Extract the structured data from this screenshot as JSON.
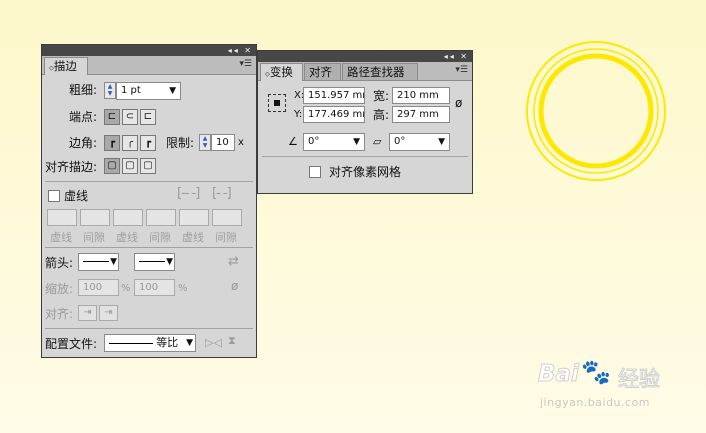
{
  "stroke_panel": {
    "tab": "描边",
    "weight_label": "粗细:",
    "weight_value": "1 pt",
    "cap_label": "端点:",
    "corner_label": "边角:",
    "limit_label": "限制:",
    "limit_value": "10",
    "limit_unit": "x",
    "align_label": "对齐描边:",
    "dashed_label": "虚线",
    "dash_headers": [
      "虚线",
      "间隙",
      "虚线",
      "间隙",
      "虚线",
      "间隙"
    ],
    "arrow_label": "箭头:",
    "scale_label": "缩放:",
    "scale_value1": "100",
    "scale_value2": "100",
    "scale_unit": "%",
    "align2_label": "对齐:",
    "profile_label": "配置文件:",
    "profile_value": "等比"
  },
  "transform_panel": {
    "tabs": [
      "变换",
      "对齐",
      "路径查找器"
    ],
    "x_label": "X:",
    "x_value": "151.957 mm",
    "y_label": "Y:",
    "y_value": "177.469 mm",
    "w_label": "宽:",
    "w_value": "210 mm",
    "h_label": "高:",
    "h_value": "297 mm",
    "rotate_value": "0°",
    "shear_value": "0°",
    "pixel_grid_label": "对齐像素网格"
  },
  "watermark": {
    "text": "Bai",
    "text2": "经验",
    "url": "jingyan.baidu.com"
  },
  "colors": {
    "ring": "#ffe800",
    "panel_bg": "#d6d6d6",
    "titlebar": "#474747"
  }
}
